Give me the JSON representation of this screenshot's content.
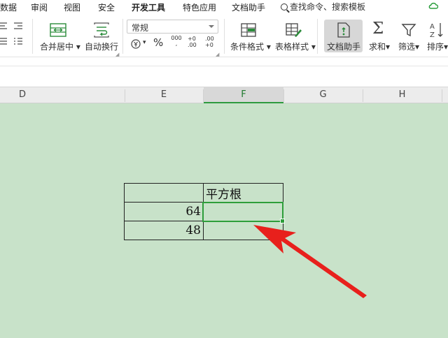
{
  "menu": {
    "items": [
      "数据",
      "审阅",
      "视图",
      "安全",
      "开发工具",
      "特色应用",
      "文档助手"
    ],
    "search_placeholder": "查找命令、搜索模板"
  },
  "ribbon": {
    "merge_center": "合并居中",
    "wrap_text": "自动换行",
    "number_format": "常规",
    "percent": "%",
    "thousands": "000",
    "inc_decimal": "+0 .00",
    "dec_decimal": ".00 +0",
    "conditional_format": "条件格式",
    "table_style": "表格样式",
    "doc_helper": "文档助手",
    "sum": "求和",
    "filter": "筛选",
    "sort": "排序"
  },
  "columns": [
    "D",
    "E",
    "F",
    "G",
    "H"
  ],
  "selected_column": "F",
  "table": {
    "rows": [
      [
        "",
        "平方根"
      ],
      [
        "64",
        ""
      ],
      [
        "48",
        ""
      ]
    ]
  },
  "colors": {
    "sheet_background": "#c8e2c9",
    "selection_green": "#2e9e3a",
    "arrow_red": "#e8201c"
  }
}
